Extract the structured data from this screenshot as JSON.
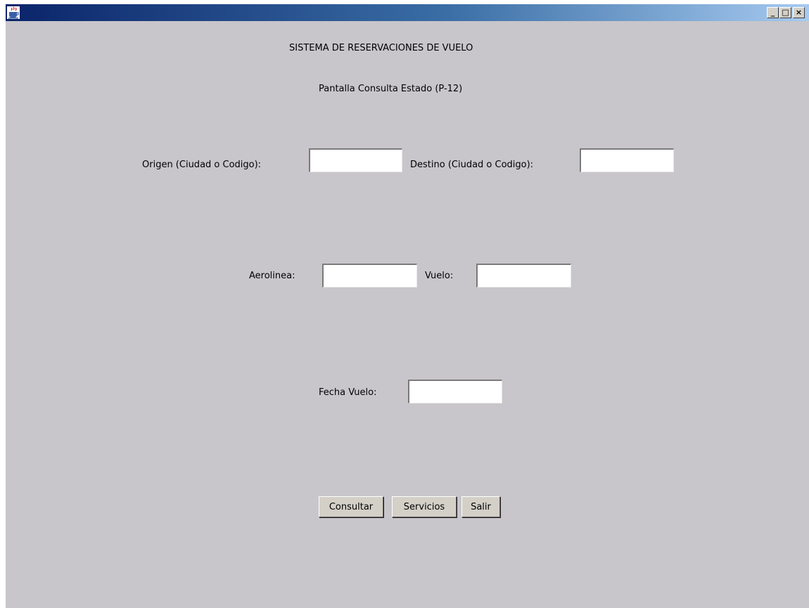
{
  "window": {
    "title": "",
    "controls": {
      "minimize": "_",
      "maximize": "□",
      "close": "×"
    },
    "titlebar_colors": [
      "#0a246a",
      "#a6caf0"
    ],
    "background": "#c8c6cb"
  },
  "header": {
    "title": "SISTEMA DE RESERVACIONES DE VUELO",
    "subtitle": "Pantalla Consulta Estado (P-12)"
  },
  "form": {
    "origen": {
      "label": "Origen (Ciudad o Codigo):",
      "value": ""
    },
    "destino": {
      "label": "Destino (Ciudad o Codigo):",
      "value": ""
    },
    "aerolinea": {
      "label": "Aerolinea:",
      "value": ""
    },
    "vuelo": {
      "label": "Vuelo:",
      "value": ""
    },
    "fecha": {
      "label": "Fecha Vuelo:",
      "value": ""
    }
  },
  "buttons": {
    "consultar": "Consultar",
    "servicios": "Servicios",
    "salir": "Salir"
  },
  "icons": {
    "app": "java-cup-icon"
  }
}
